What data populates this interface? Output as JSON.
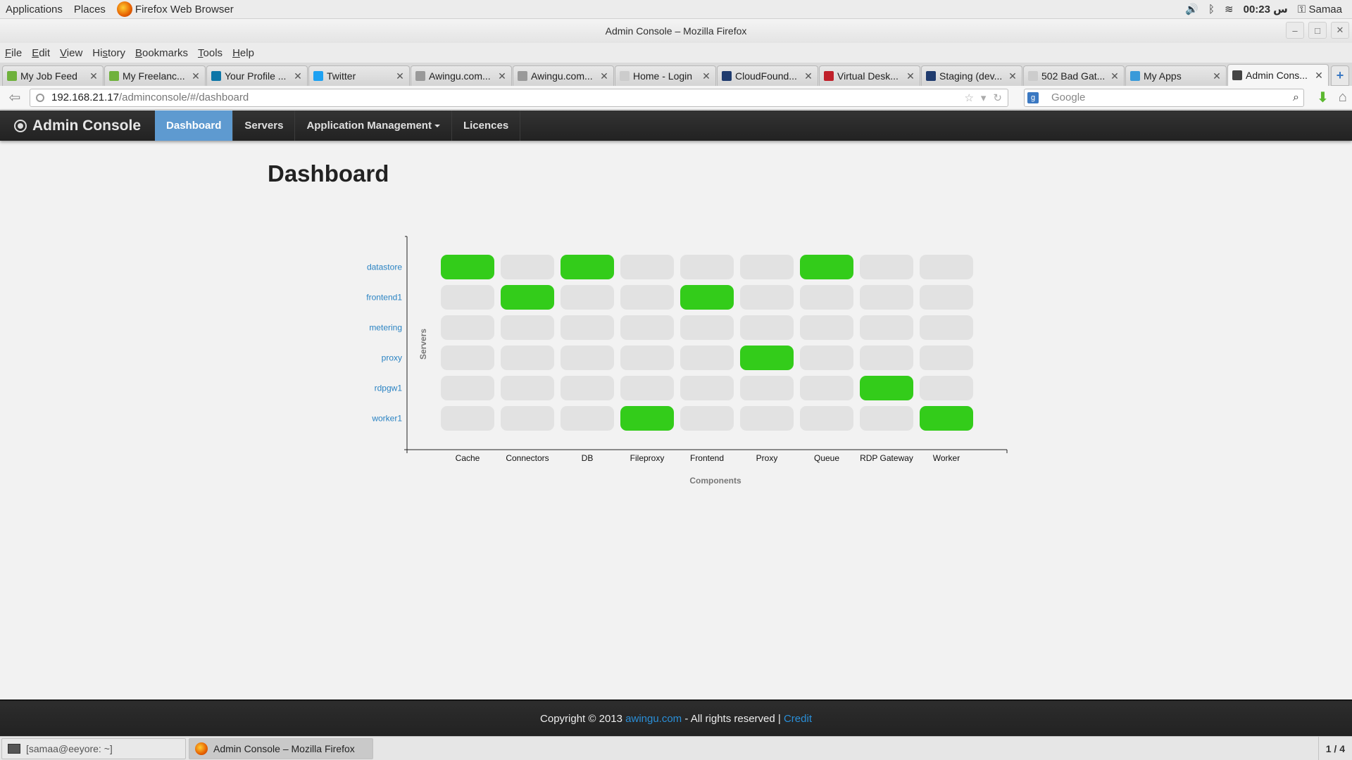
{
  "top_panel": {
    "applications": "Applications",
    "places": "Places",
    "app_name": "Firefox Web Browser",
    "clock": "00:23 س",
    "user": "Samaa"
  },
  "window": {
    "title": "Admin Console – Mozilla Firefox"
  },
  "menu": {
    "items": [
      {
        "pre": "",
        "u": "F",
        "post": "ile"
      },
      {
        "pre": "",
        "u": "E",
        "post": "dit"
      },
      {
        "pre": "",
        "u": "V",
        "post": "iew"
      },
      {
        "pre": "Hi",
        "u": "s",
        "post": "tory"
      },
      {
        "pre": "",
        "u": "B",
        "post": "ookmarks"
      },
      {
        "pre": "",
        "u": "T",
        "post": "ools"
      },
      {
        "pre": "",
        "u": "H",
        "post": "elp"
      }
    ]
  },
  "tabs": [
    {
      "label": "My Job Feed",
      "icon_color": "#6fb13c",
      "icon": "job-feed-icon"
    },
    {
      "label": "My Freelanc...",
      "icon_color": "#6fb13c",
      "icon": "freelance-icon"
    },
    {
      "label": "Your Profile ...",
      "icon_color": "#0e76a8",
      "icon": "linkedin-icon"
    },
    {
      "label": "Twitter",
      "icon_color": "#1da1f2",
      "icon": "twitter-icon"
    },
    {
      "label": "Awingu.com...",
      "icon_color": "#999999",
      "icon": "page-icon"
    },
    {
      "label": "Awingu.com...",
      "icon_color": "#999999",
      "icon": "page-icon"
    },
    {
      "label": "Home - Login",
      "icon_color": "#cccccc",
      "icon": "page-icon"
    },
    {
      "label": "CloudFound...",
      "icon_color": "#1f3b6e",
      "icon": "cloudfoundry-icon"
    },
    {
      "label": "Virtual Desk...",
      "icon_color": "#c0202a",
      "icon": "shield-icon"
    },
    {
      "label": "Staging (dev...",
      "icon_color": "#1f3b6e",
      "icon": "staging-icon"
    },
    {
      "label": "502 Bad Gat...",
      "icon_color": "#cccccc",
      "icon": "page-icon"
    },
    {
      "label": "My Apps",
      "icon_color": "#3a9ad9",
      "icon": "cloud-icon"
    },
    {
      "label": "Admin Cons...",
      "icon_color": "#444444",
      "icon": "admin-icon",
      "active": true
    }
  ],
  "nav": {
    "url_host": "192.168.21.17",
    "url_path": "/adminconsole/#/dashboard",
    "search_placeholder": "Google"
  },
  "app": {
    "brand": "Admin Console",
    "nav_items": [
      {
        "label": "Dashboard",
        "active": true
      },
      {
        "label": "Servers"
      },
      {
        "label": "Application Management",
        "dropdown": true
      },
      {
        "label": "Licences"
      }
    ],
    "page_title": "Dashboard"
  },
  "chart_data": {
    "type": "heatmap",
    "xlabel": "Components",
    "ylabel": "Servers",
    "columns": [
      "Cache",
      "Connectors",
      "DB",
      "Fileproxy",
      "Frontend",
      "Proxy",
      "Queue",
      "RDP Gateway",
      "Worker"
    ],
    "rows": [
      "datastore",
      "frontend1",
      "metering",
      "proxy",
      "rdpgw1",
      "worker1"
    ],
    "matrix": [
      [
        1,
        0,
        1,
        0,
        0,
        0,
        1,
        0,
        0
      ],
      [
        0,
        1,
        0,
        0,
        1,
        0,
        0,
        0,
        0
      ],
      [
        0,
        0,
        0,
        0,
        0,
        0,
        0,
        0,
        0
      ],
      [
        0,
        0,
        0,
        0,
        0,
        1,
        0,
        0,
        0
      ],
      [
        0,
        0,
        0,
        0,
        0,
        0,
        0,
        1,
        0
      ],
      [
        0,
        0,
        0,
        1,
        0,
        0,
        0,
        0,
        1
      ]
    ],
    "colors": {
      "on": "#33cc1a",
      "off": "#e2e2e2"
    }
  },
  "footer": {
    "copyright": "Copyright © 2013 ",
    "link": "awingu.com",
    "rights": " - All rights reserved | ",
    "credit": "Credit"
  },
  "taskbar": {
    "terminal": "[samaa@eeyore: ~]",
    "firefox": "Admin Console – Mozilla Firefox",
    "workspace": "1 / 4"
  }
}
